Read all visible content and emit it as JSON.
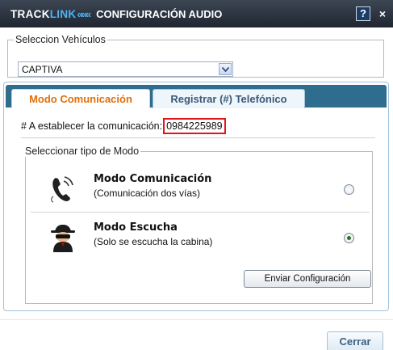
{
  "window": {
    "brand_part1": "TRACK",
    "brand_part2": "LINK",
    "brand_chevrons": "«««",
    "title": "CONFIGURACIÓN AUDIO",
    "help_label": "?",
    "close_label": "×"
  },
  "vehicle": {
    "legend": "Seleccion Vehículos",
    "selected": "CAPTIVA",
    "dropdown_icon": "chevron-down-icon"
  },
  "tabs": [
    {
      "label": "Modo Comunicación",
      "active": true
    },
    {
      "label": "Registrar (#) Telefónico",
      "active": false
    }
  ],
  "communication": {
    "label": "# A establecer la comunicación:",
    "phone": "0984225989"
  },
  "mode_group": {
    "legend": "Seleccionar tipo de Modo",
    "modes": [
      {
        "title": "Modo Comunicación",
        "subtitle": "(Comunicación dos vías)",
        "icon": "phone-handset-icon",
        "selected": false
      },
      {
        "title": "Modo Escucha",
        "subtitle": "(Solo se escucha la cabina)",
        "icon": "spy-icon",
        "selected": true
      }
    ],
    "send_button": "Enviar Configuración"
  },
  "footer": {
    "close_button": "Cerrar"
  },
  "colors": {
    "title_bar": "#2a323e",
    "brand_accent": "#4fb2ef",
    "tab_strip": "#2f6d8f",
    "active_tab_text": "#e06f08",
    "phone_highlight": "#e4141b"
  }
}
